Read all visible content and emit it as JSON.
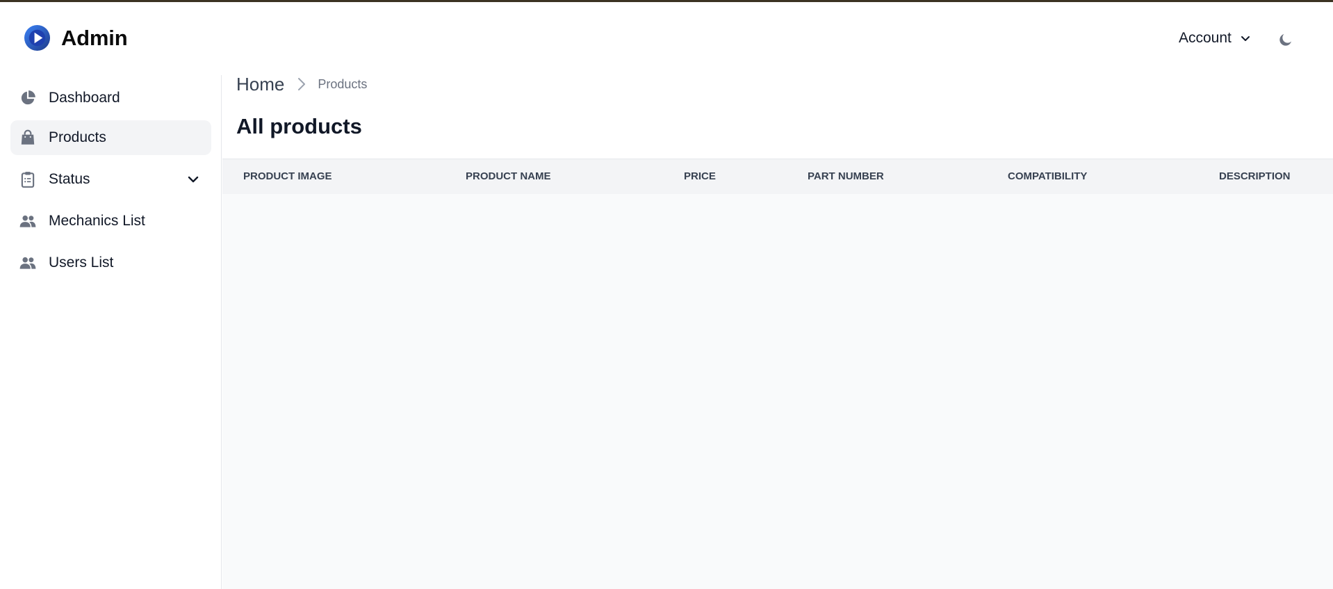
{
  "app": {
    "title": "Admin"
  },
  "header": {
    "account_label": "Account"
  },
  "sidebar": {
    "items": [
      {
        "label": "Dashboard",
        "icon": "pie-chart-icon"
      },
      {
        "label": "Products",
        "icon": "shopping-bag-icon",
        "active": true
      },
      {
        "label": "Status",
        "icon": "clipboard-list-icon",
        "expandable": true
      },
      {
        "label": "Mechanics List",
        "icon": "users-icon"
      },
      {
        "label": "Users List",
        "icon": "users-icon"
      }
    ]
  },
  "breadcrumb": {
    "home": "Home",
    "current": "Products"
  },
  "main": {
    "title": "All products"
  },
  "table": {
    "columns": [
      "PRODUCT IMAGE",
      "PRODUCT NAME",
      "PRICE",
      "PART NUMBER",
      "COMPATIBILITY",
      "DESCRIPTION"
    ],
    "rows": []
  },
  "colors": {
    "brand": "#1d4ed8",
    "active_bg": "#f3f4f6",
    "table_header_bg": "#f3f4f6",
    "icon_gray": "#6b7280"
  }
}
